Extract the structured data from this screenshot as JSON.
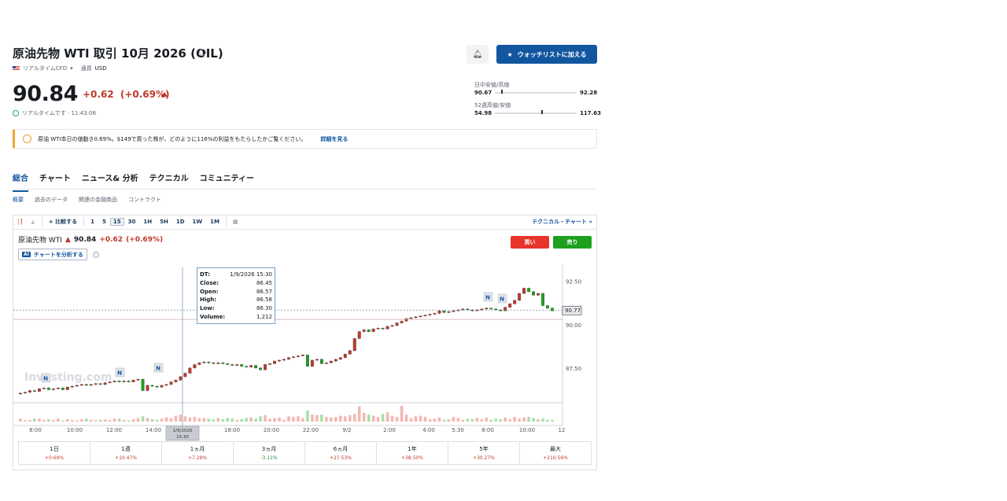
{
  "header": {
    "title": "原油先物 WTI 取引 10月 2026 (OIL)",
    "sub": {
      "flag": "us-flag",
      "type": "リアルタイムCFD",
      "currency_label": "通貨",
      "currency": "USD"
    },
    "price": "90.84",
    "change": "+0.62",
    "change_pct": "(+0.69%)",
    "realtime": "リアルタイムです · 11:43:08"
  },
  "actions": {
    "alert_icon": "bell-plus-icon",
    "watchlist_label": "ウォッチリストに加える"
  },
  "ranges": {
    "day": {
      "label": "日中安値/高値",
      "low": "90.67",
      "high": "92.28",
      "position": 0.08
    },
    "week52": {
      "label": "52週高値/安値",
      "low": "54.98",
      "high": "117.63",
      "position": 0.57
    }
  },
  "banner": {
    "text": "原油 WTI本日の値動き0.69%。$149で買った株が、どのように116%の利益をもたらしたかご覧ください。",
    "link": "詳細を見る"
  },
  "tabs": [
    "総合",
    "チャート",
    "ニュース& 分析",
    "テクニカル",
    "コミュニティー"
  ],
  "subtabs": [
    "概要",
    "過去のデータ",
    "関連の金融商品",
    "コントラクト"
  ],
  "toolbar": {
    "compare": "比較する",
    "intervals": [
      "1",
      "5",
      "15",
      "30",
      "1H",
      "5H",
      "1D",
      "1W",
      "1M"
    ],
    "active_interval": "15",
    "technical_chart": "テクニカル・チャート »"
  },
  "chart_legend": {
    "name": "原油先物 WTI",
    "price": "90.84",
    "change": "+0.62",
    "change_pct": "(+0.69%)"
  },
  "analyze": {
    "badge": "AI",
    "label": "チャートを分析する"
  },
  "trade": {
    "buy": "買い",
    "sell": "売り"
  },
  "tooltip": {
    "rows": [
      {
        "k": "DT:",
        "v": "1/9/2026 15:30"
      },
      {
        "k": "Close:",
        "v": "86.45"
      },
      {
        "k": "Open:",
        "v": "86.57"
      },
      {
        "k": "High:",
        "v": "86.58"
      },
      {
        "k": "Low:",
        "v": "86.30"
      },
      {
        "k": "Volume:",
        "v": "1,212"
      }
    ]
  },
  "chart_data": {
    "type": "candlestick",
    "y_ticks": [
      "92.50",
      "90.00",
      "87.50"
    ],
    "ylim": [
      85.5,
      93.3
    ],
    "x_ticks": [
      "8:00",
      "10:00",
      "12:00",
      "14:00",
      "18:00",
      "20:00",
      "22:00",
      "9/2",
      "2:00",
      "4:00",
      "5:30",
      "8:00",
      "10:00",
      "12"
    ],
    "crosshair_label": "1/9/2026\n15:30",
    "current_price_label": "90.77",
    "watermark": "Investing.com",
    "news_markers": [
      "N",
      "N",
      "N",
      "N",
      "N"
    ],
    "closes": [
      86.05,
      86.1,
      86.2,
      86.15,
      86.3,
      86.35,
      86.25,
      86.3,
      86.35,
      86.25,
      86.4,
      86.45,
      86.5,
      86.55,
      86.5,
      86.55,
      86.6,
      86.55,
      86.65,
      86.7,
      86.75,
      86.7,
      86.75,
      86.7,
      86.8,
      86.85,
      86.2,
      86.5,
      86.45,
      86.4,
      86.5,
      86.55,
      86.7,
      86.8,
      87.0,
      87.2,
      87.5,
      87.7,
      87.8,
      87.85,
      87.8,
      87.75,
      87.8,
      87.75,
      87.7,
      87.65,
      87.7,
      87.6,
      87.55,
      87.65,
      87.5,
      87.4,
      87.7,
      87.75,
      87.9,
      87.95,
      88.0,
      88.1,
      88.15,
      88.2,
      88.25,
      87.6,
      87.95,
      88.0,
      87.75,
      87.8,
      87.9,
      88.0,
      88.1,
      88.3,
      88.5,
      89.2,
      89.6,
      89.7,
      89.6,
      89.75,
      89.8,
      89.75,
      89.9,
      89.95,
      90.1,
      90.2,
      90.35,
      90.4,
      90.45,
      90.5,
      90.55,
      90.6,
      90.65,
      90.8,
      90.7,
      90.75,
      90.8,
      90.85,
      90.9,
      90.85,
      90.8,
      90.85,
      90.9,
      90.95,
      90.9,
      90.85,
      90.8,
      91.0,
      91.2,
      91.4,
      91.8,
      92.1,
      91.9,
      91.7,
      91.8,
      91.1,
      90.95,
      90.8
    ],
    "volumes": [
      1,
      0.5,
      0.5,
      1,
      1,
      0.6,
      0.8,
      0.5,
      1,
      0.4,
      0.8,
      0.6,
      0.4,
      0.8,
      1,
      0.6,
      0.4,
      0.6,
      0.7,
      0.5,
      1,
      1,
      0.6,
      0.4,
      0.8,
      1.2,
      1.8,
      1.2,
      0.8,
      0.6,
      1,
      1.5,
      1.2,
      2,
      2.4,
      1.8,
      1.4,
      1.6,
      1.2,
      1.2,
      1,
      0.8,
      1.2,
      0.8,
      1.2,
      1,
      0.6,
      0.8,
      1.2,
      1.4,
      1,
      1.8,
      2.2,
      1,
      1.2,
      1.4,
      0.6,
      1.8,
      1.6,
      1.8,
      1.2,
      3.8,
      2.4,
      2.2,
      2.4,
      1.6,
      1.4,
      1.6,
      2,
      1.8,
      2.2,
      2.6,
      5.2,
      3,
      2.4,
      2,
      1.6,
      2.6,
      3.2,
      2,
      1.6,
      5.4,
      2.4,
      1.2,
      1.8,
      2,
      1.6,
      0.8,
      1,
      1.4,
      0.6,
      0.8,
      1.6,
      1.2,
      0.6,
      1,
      0.8,
      1.2,
      0.8,
      1.4,
      0.6,
      1,
      0.8,
      1.4,
      0.8,
      1.6,
      1,
      1.4,
      1.6,
      1.2,
      0.8,
      1,
      0.6,
      0.6
    ]
  },
  "performance": [
    {
      "label": "1日",
      "value": "+0.69%",
      "negative": false
    },
    {
      "label": "1週",
      "value": "+10.47%",
      "negative": false
    },
    {
      "label": "1ヵ月",
      "value": "+7.29%",
      "negative": false
    },
    {
      "label": "3ヵ月",
      "value": "-3.11%",
      "negative": true
    },
    {
      "label": "6ヵ月",
      "value": "+27.53%",
      "negative": false
    },
    {
      "label": "1年",
      "value": "+38.50%",
      "negative": false
    },
    {
      "label": "5年",
      "value": "+30.27%",
      "negative": false
    },
    {
      "label": "最大",
      "value": "+210.56%",
      "negative": false
    }
  ],
  "colors": {
    "up": "#c0392b",
    "down": "#1ea01e",
    "accent": "#1256a0"
  }
}
